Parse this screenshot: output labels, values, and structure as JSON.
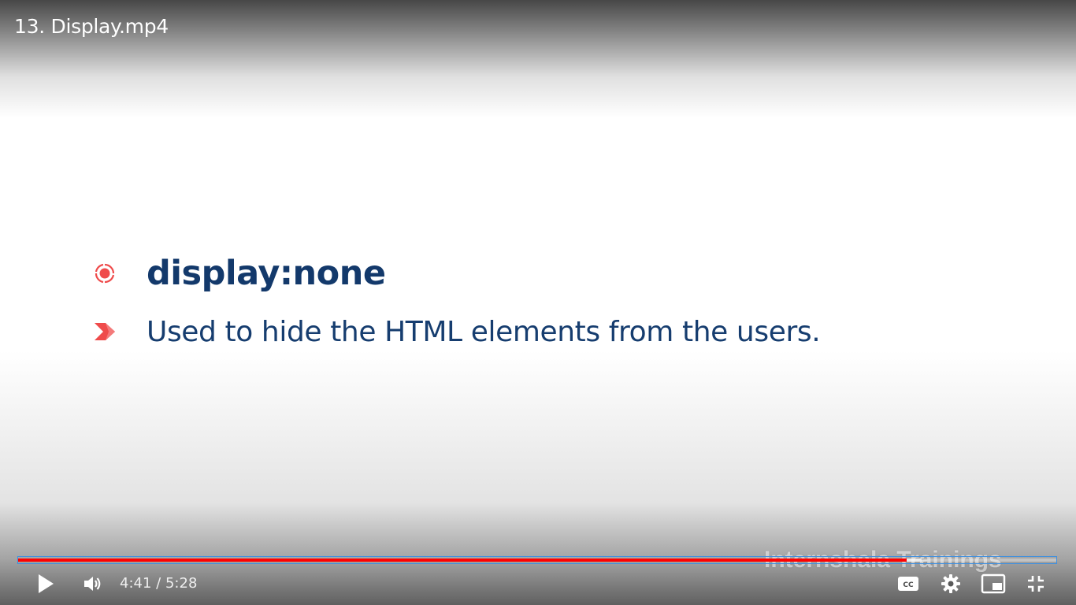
{
  "video": {
    "title": "13. Display.mp4"
  },
  "slide": {
    "heading": "display:none",
    "bullet": "Used to hide the HTML elements from the users.",
    "accent_color": "#ef4b4b",
    "text_color": "#163d6f"
  },
  "watermark": {
    "text": "Internshala Trainings"
  },
  "player": {
    "current_time": "4:41",
    "separator": "/",
    "duration": "5:28",
    "progress_fraction": 0.856,
    "buffered_fraction": 0.87,
    "progress_color": "#ff0000",
    "icons": {
      "play": "play-icon",
      "volume": "volume-icon",
      "captions": "captions-icon",
      "settings": "gear-icon",
      "miniplayer": "miniplayer-icon",
      "exit_fullscreen": "exit-fullscreen-icon"
    }
  }
}
